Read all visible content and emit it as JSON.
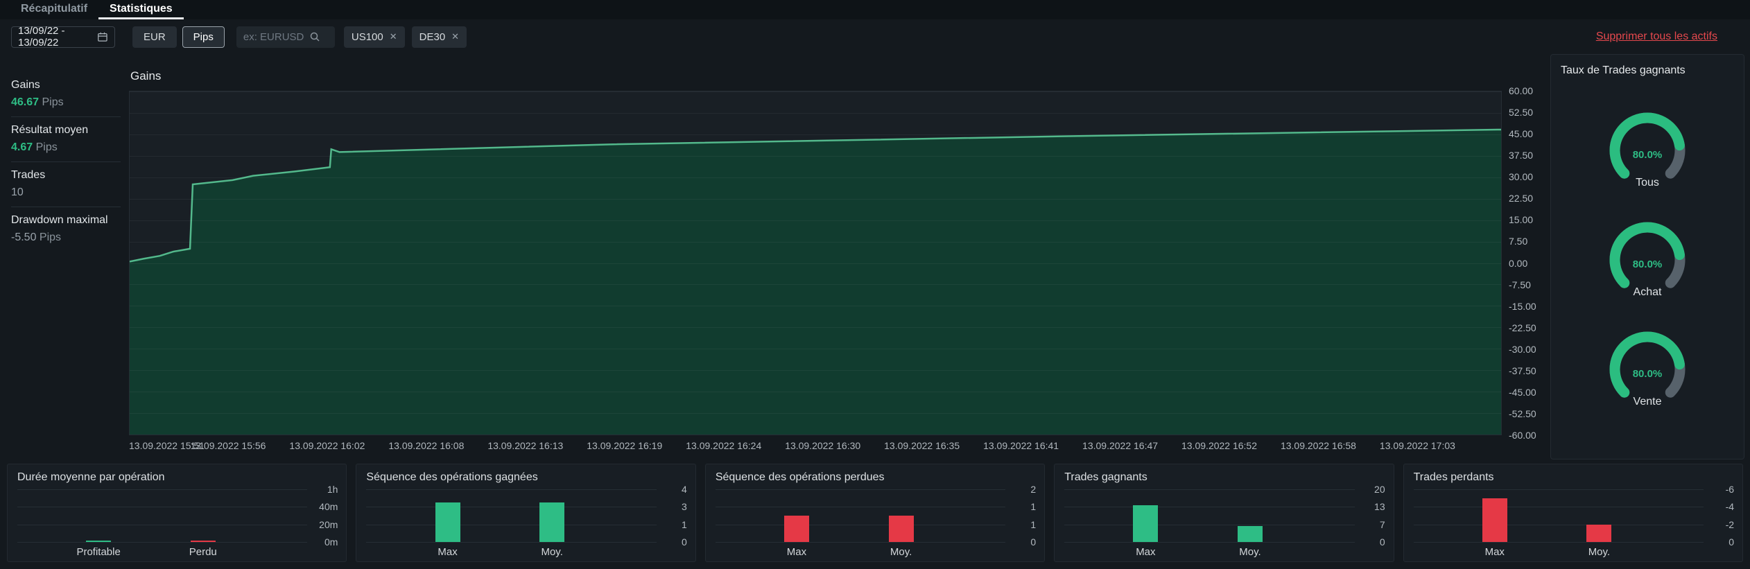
{
  "tabs": [
    {
      "label": "Récapitulatif",
      "active": false
    },
    {
      "label": "Statistiques",
      "active": true
    }
  ],
  "filters": {
    "date_range": "13/09/22 - 13/09/22",
    "currency_button": "EUR",
    "unit_button": "Pips",
    "search_placeholder": "ex: EURUSD",
    "tags": [
      {
        "label": "US100"
      },
      {
        "label": "DE30"
      }
    ],
    "delete_link": "Supprimer tous les actifs"
  },
  "sidebar": {
    "items": [
      {
        "label": "Gains",
        "value": "46.67",
        "unit": "Pips",
        "color": "green"
      },
      {
        "label": "Résultat moyen",
        "value": "4.67",
        "unit": "Pips",
        "color": "green"
      },
      {
        "label": "Trades",
        "value": "10",
        "unit": "",
        "color": "dim"
      },
      {
        "label": "Drawdown maximal",
        "value": "-5.50",
        "unit": "Pips",
        "color": "dim"
      }
    ]
  },
  "gauges_panel": {
    "title": "Taux de Trades gagnants",
    "items": [
      {
        "display": "80.0%",
        "percent": 80,
        "label": "Tous"
      },
      {
        "display": "80.0%",
        "percent": 80,
        "label": "Achat"
      },
      {
        "display": "80.0%",
        "percent": 80,
        "label": "Vente"
      }
    ]
  },
  "colors": {
    "green": "#2ebd85",
    "red": "#e53946",
    "link_red": "#e5484d",
    "gauge_track": "#57626b"
  },
  "chart_data": [
    {
      "type": "area",
      "title": "Gains",
      "unit": "Pips",
      "ylim": [
        -60,
        60
      ],
      "ytick_step": 7.5,
      "grid": true,
      "legend": "none",
      "x_labels": [
        "13.09.2022 15:51",
        "13.09.2022 15:56",
        "13.09.2022 16:02",
        "13.09.2022 16:08",
        "13.09.2022 16:13",
        "13.09.2022 16:19",
        "13.09.2022 16:24",
        "13.09.2022 16:30",
        "13.09.2022 16:35",
        "13.09.2022 16:41",
        "13.09.2022 16:47",
        "13.09.2022 16:52",
        "13.09.2022 16:58",
        "13.09.2022 17:03"
      ],
      "points": [
        [
          0.0,
          0.5
        ],
        [
          0.01,
          1.5
        ],
        [
          0.022,
          2.5
        ],
        [
          0.032,
          4.0
        ],
        [
          0.044,
          5.0
        ],
        [
          0.046,
          27.5
        ],
        [
          0.075,
          29.0
        ],
        [
          0.09,
          30.5
        ],
        [
          0.12,
          32.0
        ],
        [
          0.146,
          33.5
        ],
        [
          0.147,
          39.8
        ],
        [
          0.153,
          38.8
        ],
        [
          0.35,
          41.5
        ],
        [
          0.7,
          44.5
        ],
        [
          1.0,
          46.67
        ]
      ],
      "final_value": 46.67,
      "line_color": "#53b98c",
      "fill_color": "#104231"
    },
    {
      "type": "bar",
      "title": "Durée moyenne par opération",
      "categories": [
        "Profitable",
        "Perdu"
      ],
      "values": [
        1.5,
        1.5
      ],
      "unit": "minutes",
      "axis_max": 60,
      "tick_labels": [
        "1h",
        "40m",
        "20m",
        "0m"
      ],
      "bar_colors": [
        "#2ebd85",
        "#e53946"
      ]
    },
    {
      "type": "bar",
      "title": "Séquence des opérations gagnées",
      "categories": [
        "Max",
        "Moy."
      ],
      "values": [
        3,
        3
      ],
      "axis_max": 4,
      "tick_labels": [
        "4",
        "3",
        "1",
        "0"
      ],
      "bar_colors": [
        "#2ebd85",
        "#2ebd85"
      ]
    },
    {
      "type": "bar",
      "title": "Séquence des opérations perdues",
      "categories": [
        "Max",
        "Moy."
      ],
      "values": [
        1,
        1
      ],
      "axis_max": 2,
      "tick_labels": [
        "2",
        "1",
        "1",
        "0"
      ],
      "bar_colors": [
        "#e53946",
        "#e53946"
      ]
    },
    {
      "type": "bar",
      "title": "Trades gagnants",
      "categories": [
        "Max",
        "Moy."
      ],
      "values": [
        14,
        6
      ],
      "axis_max": 20,
      "tick_labels": [
        "20",
        "13",
        "7",
        "0"
      ],
      "bar_colors": [
        "#2ebd85",
        "#2ebd85"
      ]
    },
    {
      "type": "bar",
      "title": "Trades perdants",
      "categories": [
        "Max",
        "Moy."
      ],
      "values": [
        -5,
        -2
      ],
      "axis_max": -6,
      "tick_labels": [
        "-6",
        "-4",
        "-2",
        "0"
      ],
      "bar_colors": [
        "#e53946",
        "#e53946"
      ]
    }
  ]
}
